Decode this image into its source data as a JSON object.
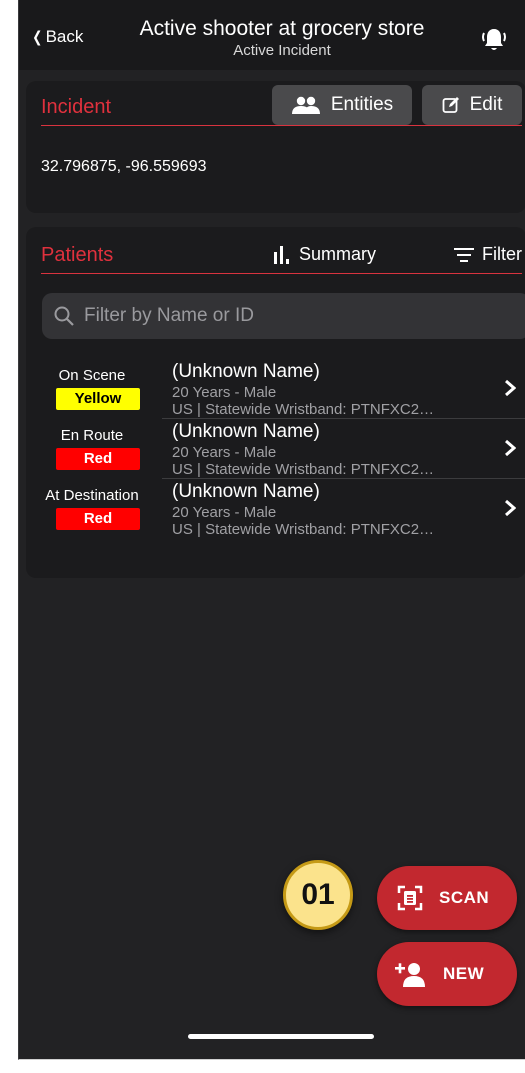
{
  "header": {
    "back_label": "Back",
    "title": "Active shooter at grocery store",
    "subtitle": "Active Incident",
    "bell_icon": "alarm-bell-icon"
  },
  "incident": {
    "section_title": "Incident",
    "entities_label": "Entities",
    "edit_label": "Edit",
    "coordinates": "32.796875, -96.559693"
  },
  "patients": {
    "section_title": "Patients",
    "summary_label": "Summary",
    "filter_label": "Filter",
    "search_placeholder": "Filter by Name or ID",
    "rows": [
      {
        "status": "On Scene",
        "triage": "Yellow",
        "triage_color": "#ffff00",
        "triage_text_color": "#000000",
        "name": "(Unknown Name)",
        "age_sex": "20 Years - Male",
        "id_line": "US | Statewide Wristband: PTNFXC2…"
      },
      {
        "status": "En Route",
        "triage": "Red",
        "triage_color": "#ff0000",
        "triage_text_color": "#ffffff",
        "name": "(Unknown Name)",
        "age_sex": "20 Years - Male",
        "id_line": "US | Statewide Wristband: PTNFXC2…"
      },
      {
        "status": "At Destination",
        "triage": "Red",
        "triage_color": "#ff0000",
        "triage_text_color": "#ffffff",
        "name": "(Unknown Name)",
        "age_sex": "20 Years - Male",
        "id_line": "US | Statewide Wristband: PTNFXC2…"
      }
    ]
  },
  "actions": {
    "scan_label": "SCAN",
    "new_label": "NEW",
    "badge": "01"
  },
  "colors": {
    "accent_red": "#e0313d",
    "fab_red": "#c2282f",
    "badge_fill": "#fbe38c"
  }
}
